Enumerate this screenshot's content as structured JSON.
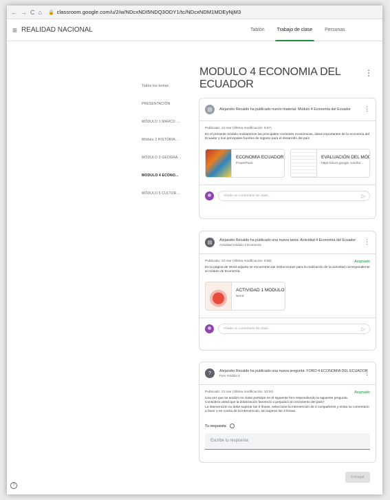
{
  "browser": {
    "url": "classroom.google.com/u/2/w/NDcxNDI5NDQ3ODY1/tc/NDcxNDM1MDEyNjM3"
  },
  "app": {
    "name": "REALIDAD NACIONAL",
    "tabs": [
      "Tablón",
      "Trabajo de clase",
      "Personas"
    ],
    "active_tab": "Trabajo de clase"
  },
  "topics": [
    "Todos los temas",
    "PRESENTACIÓN",
    "MÓDULO 1 MARCO ...",
    "Módulo 2 HISTÓRIA...",
    "MÓDULO 3 GEOGRA...",
    "MODULO 4 ECONO...",
    "MÓDULO 5 CULTUR..."
  ],
  "active_topic": "MODULO 4 ECONO...",
  "section_title": "MODULO 4 ECONOMIA DEL ECUADOR",
  "posts": [
    {
      "header": "Alejandro Recalde ha publicado nuevo material: Módulo 4 Economía del Ecuador",
      "sub": "",
      "meta": "Publicado: 13 mar (Última modificación: 9:57)",
      "status": "",
      "description": "En el presente módulo revisaremos las principales corrientes económicas, datos importantes de la economía del Ecuador y sus principales fuentes de ingreso para el desarrollo del país",
      "attachments": [
        {
          "title": "ECONOMIA ECUADOR.p...",
          "sub": "PowerPoint"
        },
        {
          "title": "EVALUACIÓN DEL MÓD...",
          "sub": "https://docs.google.com/for..."
        }
      ],
      "comment_placeholder": "Añade un comentario de clase..."
    },
    {
      "header": "Alejandro Recalde ha publicado una nueva tarea: Actividad 4 Economía del Ecuador",
      "sub": "Actividad módulo 4 Economía",
      "meta": "Publicado: 13 mar (Última modificación: 9:58)",
      "status": "Asignado",
      "description": "En la página de Word adjunta se encuentran las instrucciones para la realización de la actividad correspondiente al módulo de Economía.",
      "attachments": [
        {
          "title": "ACTIVIDAD 1 MODULO 4...",
          "sub": "Word"
        }
      ],
      "comment_placeholder": "Añade un comentario de clase..."
    },
    {
      "header": "Alejandro Recalde ha publicado una nueva pregunta: FORO 4 ECONOMIA DEL ECUADOR",
      "sub": "Foro módulo 4",
      "meta": "Publicado: 13 mar (Última modificación: 10:04)",
      "status": "Asignado",
      "description_lines": [
        "Una vez que se analizó en clase participe en el siguiente foro respondiendo la siguiente pregunta.",
        "Considera usted que la dolarización favoreció o perjudicó al crecimiento del país?",
        "La intervención no debe superar las 6 líneas, seleccione la intervención de 2 compañeros y emita su comentario a favor o en contra de la intervención, sin superar las 3 líneas."
      ],
      "answer_label": "Tu respuesta",
      "answer_placeholder": "Escribe tu respuesta",
      "submit_label": "Entregar"
    }
  ],
  "help_label": "?"
}
